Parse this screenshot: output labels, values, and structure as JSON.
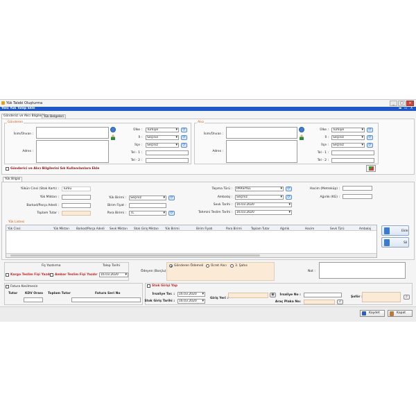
{
  "window": {
    "title": "Yük Talebi Oluşturma",
    "header": "Yeni Yük Talep Ekle",
    "controls": [
      "_",
      "□",
      "×"
    ],
    "blue_controls": [
      "▬",
      "▭",
      "X"
    ]
  },
  "tabs": {
    "top": [
      "Gönderici ve Alıcı Bilgileri",
      "Yük Belgeleri"
    ],
    "mid": "Yük Bilgisi"
  },
  "sender": {
    "title": "Gönderen",
    "name_label": "İsim/Ünvan :",
    "address_label": "Adres :",
    "country_label": "Ülke :",
    "country_value": "Türkiye",
    "city_label": "İl :",
    "city_value": "Seçiniz",
    "district_label": "İlçe :",
    "district_value": "Seçiniz",
    "tel1_label": "Tel - 1 :",
    "tel2_label": "Tel - 2 :"
  },
  "receiver": {
    "title": "Alıcı",
    "name_label": "İsim/Ünvan :",
    "address_label": "Adres :",
    "country_label": "Ülke :",
    "country_value": "Türkiye",
    "city_label": "İl :",
    "city_value": "Seçiniz",
    "district_label": "İlçe :",
    "district_value": "Seçiniz",
    "tel1_label": "Tel - 1 :",
    "tel2_label": "Tel - 2 :"
  },
  "frequent_checkbox": "Gönderici ve Alıcı Bilgilerini Sık Kullanılanlara Ekle",
  "cargo": {
    "type_label": "Yükün Cinsi (Stok Kartı) :",
    "type_value": "Tümü",
    "qty_label": "Yük Miktarı :",
    "barcode_label": "Barkod/Parça Adedi :",
    "total_label": "Toplam Tutar :",
    "unit_label": "Yük Birimi :",
    "unit_value": "Seçiniz",
    "price_label": "Birim Fiyat :",
    "currency_label": "Para Birimi :",
    "currency_value": "TL",
    "transport_label": "Taşıma Türü :",
    "transport_value": "PARSİYEL",
    "package_label": "Ambalaj :",
    "package_value": "Seçiniz",
    "ship_date_label": "Sevk Tarihi :",
    "ship_date_value": "16.03.2020",
    "delivery_label": "Tahmini Teslim Tarihi :",
    "delivery_value": "16.03.2020",
    "volume_label": "Hacim (Metreküp) :",
    "weight_label": "Ağırlık (KG) :"
  },
  "list": {
    "title": "Yük Listesi",
    "columns": [
      "Yük Cinsi",
      "Yük Miktarı",
      "Barkod/Parça Adedi",
      "Sevk Miktarı",
      "Stok Giriş Miktarı",
      "Yük Birimi",
      "Birim Fiyatı",
      "Para Birimi",
      "Toplam Tutar",
      "Ağırlık",
      "Hacim",
      "Sevk Türü",
      "Ambalaj"
    ],
    "add_button": "Ekle",
    "delete_button": "Sil"
  },
  "payment": {
    "receipt_label": "Fiş Yazdırma",
    "request_date_label": "Talep Tarihi",
    "cargo_receipt": "Kargo Teslim Fişi Yazdır",
    "warehouse_receipt": "Ambar Teslim Fişi Yazdır",
    "request_date_value": "16.03.2020",
    "payer_label": "Ödeyen (Borçlu) :",
    "options": [
      "Gönderen Ödemeli",
      "Ücret Alıcı",
      "3. Şahıs"
    ],
    "note_label": "Not :"
  },
  "invoice": {
    "checkbox": "Fatura Kesilmesin",
    "headers": [
      "Tutar",
      "KDV Oranı",
      "Toplam Tutar",
      "Fatura Seri No"
    ]
  },
  "stock": {
    "checkbox": "Stok Girişi Yap",
    "iris_date_label": "İrsaliye Tar. :",
    "iris_date_value": "16.03.2020",
    "entry_date_label": "Stok Giriş Tarihi :",
    "entry_date_value": "16.03.2020",
    "entry_place_label": "Giriş Yeri :",
    "iris_no_label": "İrsaliye No :",
    "plate_label": "Araç Plaka No:",
    "driver_label": "Şoför :"
  },
  "footer": {
    "save": "Kaydet",
    "close": "Kapat"
  },
  "colors": {
    "header_blue": "#1f57c6",
    "section_orange": "#d05a10",
    "alert_red": "#c81e1e"
  }
}
